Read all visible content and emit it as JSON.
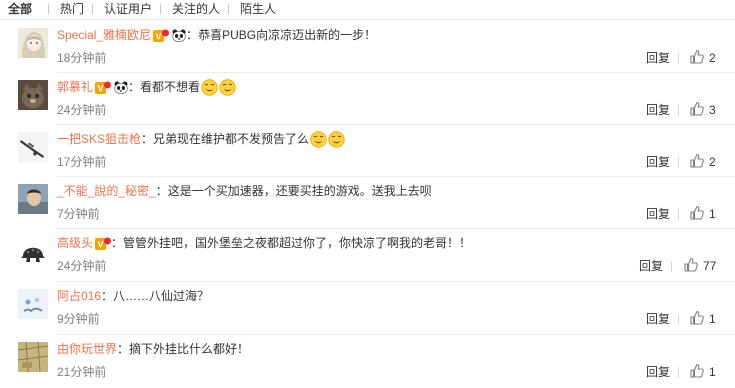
{
  "tabs": [
    "全部",
    "热门",
    "认证用户",
    "关注的人",
    "陌生人"
  ],
  "actions": {
    "reply": "回复"
  },
  "comments": [
    {
      "user": "Special_雅楠欧尼",
      "colon": "：",
      "text": "恭喜PUBG向凉凉迈出新的一步！",
      "time": "18分钟前",
      "likes": "2",
      "badge": true,
      "panda": true,
      "emoji": 0,
      "avatar": "anime-girl-avatar"
    },
    {
      "user": "郭慕礼",
      "colon": "：",
      "text": "看都不想看",
      "time": "24分钟前",
      "likes": "3",
      "badge": true,
      "panda": true,
      "emoji": 2,
      "avatar": "cat-avatar"
    },
    {
      "user": "一把SKS狙击枪",
      "colon": "：",
      "text": "兄弟现在维护都不发预告了么",
      "time": "17分钟前",
      "likes": "2",
      "badge": false,
      "panda": false,
      "emoji": 2,
      "avatar": "rifle-avatar"
    },
    {
      "user": "_不能_說的_秘密_",
      "colon": "：",
      "text": "这是一个买加速器，还要买挂的游戏。送我上去呗",
      "time": "7分钟前",
      "likes": "1",
      "badge": false,
      "panda": false,
      "emoji": 0,
      "avatar": "person-avatar"
    },
    {
      "user": "高级头",
      "colon": "：",
      "text": "管管外挂吧，国外堡垒之夜都超过你了，你快凉了啊我的老哥！！",
      "time": "24分钟前",
      "likes": "77",
      "badge": true,
      "panda": false,
      "emoji": 0,
      "avatar": "helmet-avatar"
    },
    {
      "user": "阿占016",
      "colon": "：",
      "text": "八……八仙过海？",
      "time": "9分钟前",
      "likes": "1",
      "badge": false,
      "panda": false,
      "emoji": 0,
      "avatar": "default-avatar"
    },
    {
      "user": "由你玩世界",
      "colon": "：",
      "text": "摘下外挂比什么都好！",
      "time": "21分钟前",
      "likes": "1",
      "badge": false,
      "panda": false,
      "emoji": 0,
      "avatar": "map-avatar"
    }
  ],
  "colors": {
    "username": "#eb7350",
    "time": "#808080",
    "text": "#333333"
  }
}
